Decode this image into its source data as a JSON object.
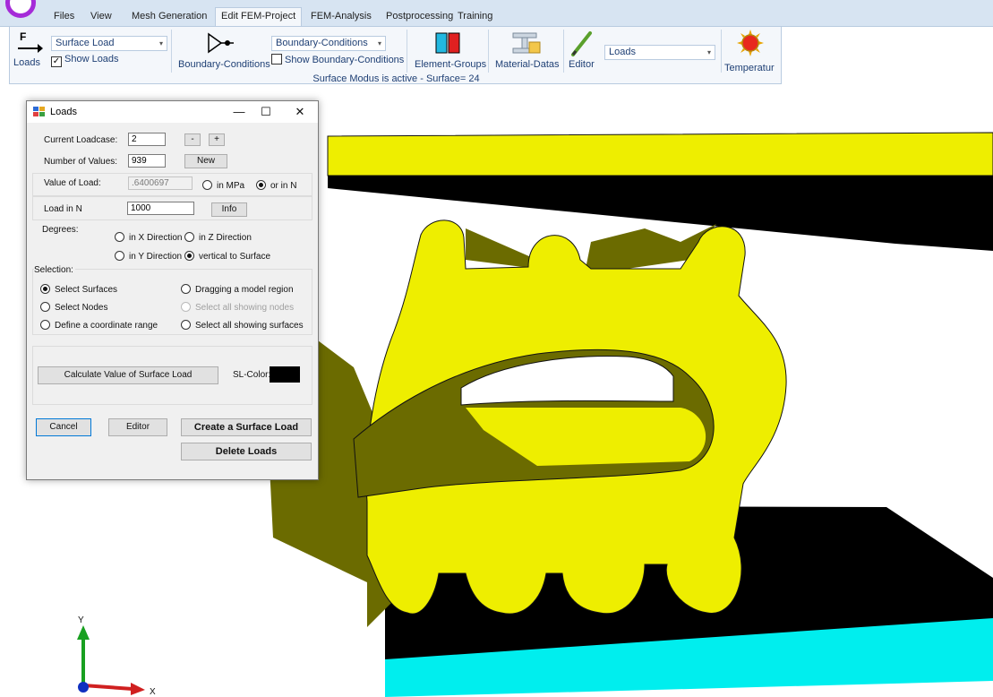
{
  "menu": {
    "items": [
      "Files",
      "View",
      "Mesh Generation",
      "Edit FEM-Project",
      "FEM-Analysis",
      "Postprocessing",
      "Training"
    ],
    "active": "Edit FEM-Project"
  },
  "ribbon": {
    "loads_label": "Loads",
    "load_type_value": "Surface Load",
    "show_loads_label": "Show Loads",
    "show_loads_checked": true,
    "boundary_conditions_label": "Boundary-Conditions",
    "boundary_combo_value": "Boundary-Conditions",
    "show_boundary_label": "Show Boundary-Conditions",
    "show_boundary_checked": false,
    "element_groups_label": "Element-Groups",
    "material_datas_label": "Material-Datas",
    "editor_label": "Editor",
    "editor_combo_value": "Loads",
    "temperature_label": "Temperatur",
    "status_text": "Surface Modus is active - Surface= 24"
  },
  "dialog": {
    "title": "Loads",
    "minimize": "—",
    "maximize": "☐",
    "close": "✕",
    "current_loadcase_label": "Current Loadcase:",
    "current_loadcase_value": "2",
    "minus_label": "-",
    "plus_label": "+",
    "number_of_values_label": "Number of Values:",
    "number_of_values_value": "939",
    "new_label": "New",
    "value_of_load_label": "Value of Load:",
    "value_of_load_value": ".6400697",
    "in_mpa_label": "in MPa",
    "or_in_n_label": "or in N",
    "unit_selected": "N",
    "load_in_n_label": "Load in N",
    "load_in_n_value": "1000",
    "info_label": "Info",
    "degrees_label": "Degrees:",
    "dir_x_label": "in X Direction",
    "dir_z_label": "in Z Direction",
    "dir_y_label": "in Y Direction",
    "dir_vertical_label": "vertical to Surface",
    "direction_selected": "vertical to Surface",
    "selection_label": "Selection:",
    "sel_surfaces_label": "Select Surfaces",
    "sel_dragging_label": "Dragging a model region",
    "sel_nodes_label": "Select Nodes",
    "sel_all_nodes_label": "Select all showing nodes",
    "sel_coord_label": "Define a coordinate range",
    "sel_all_surfaces_label": "Select all showing surfaces",
    "selection_selected": "Select Surfaces",
    "calculate_label": "Calculate Value of Surface Load",
    "sl_color_label": "SL-Color:",
    "sl_color_value": "#000000",
    "cancel_label": "Cancel",
    "editor_label": "Editor",
    "create_label": "Create a Surface Load",
    "delete_label": "Delete Loads"
  },
  "viewport": {
    "model_color": "#eeee00",
    "model_shade": "#6b6b00",
    "plate_color": "#000000",
    "floor_color": "#00eeee",
    "axis_y_label": "Y",
    "axis_x_label": "X"
  }
}
